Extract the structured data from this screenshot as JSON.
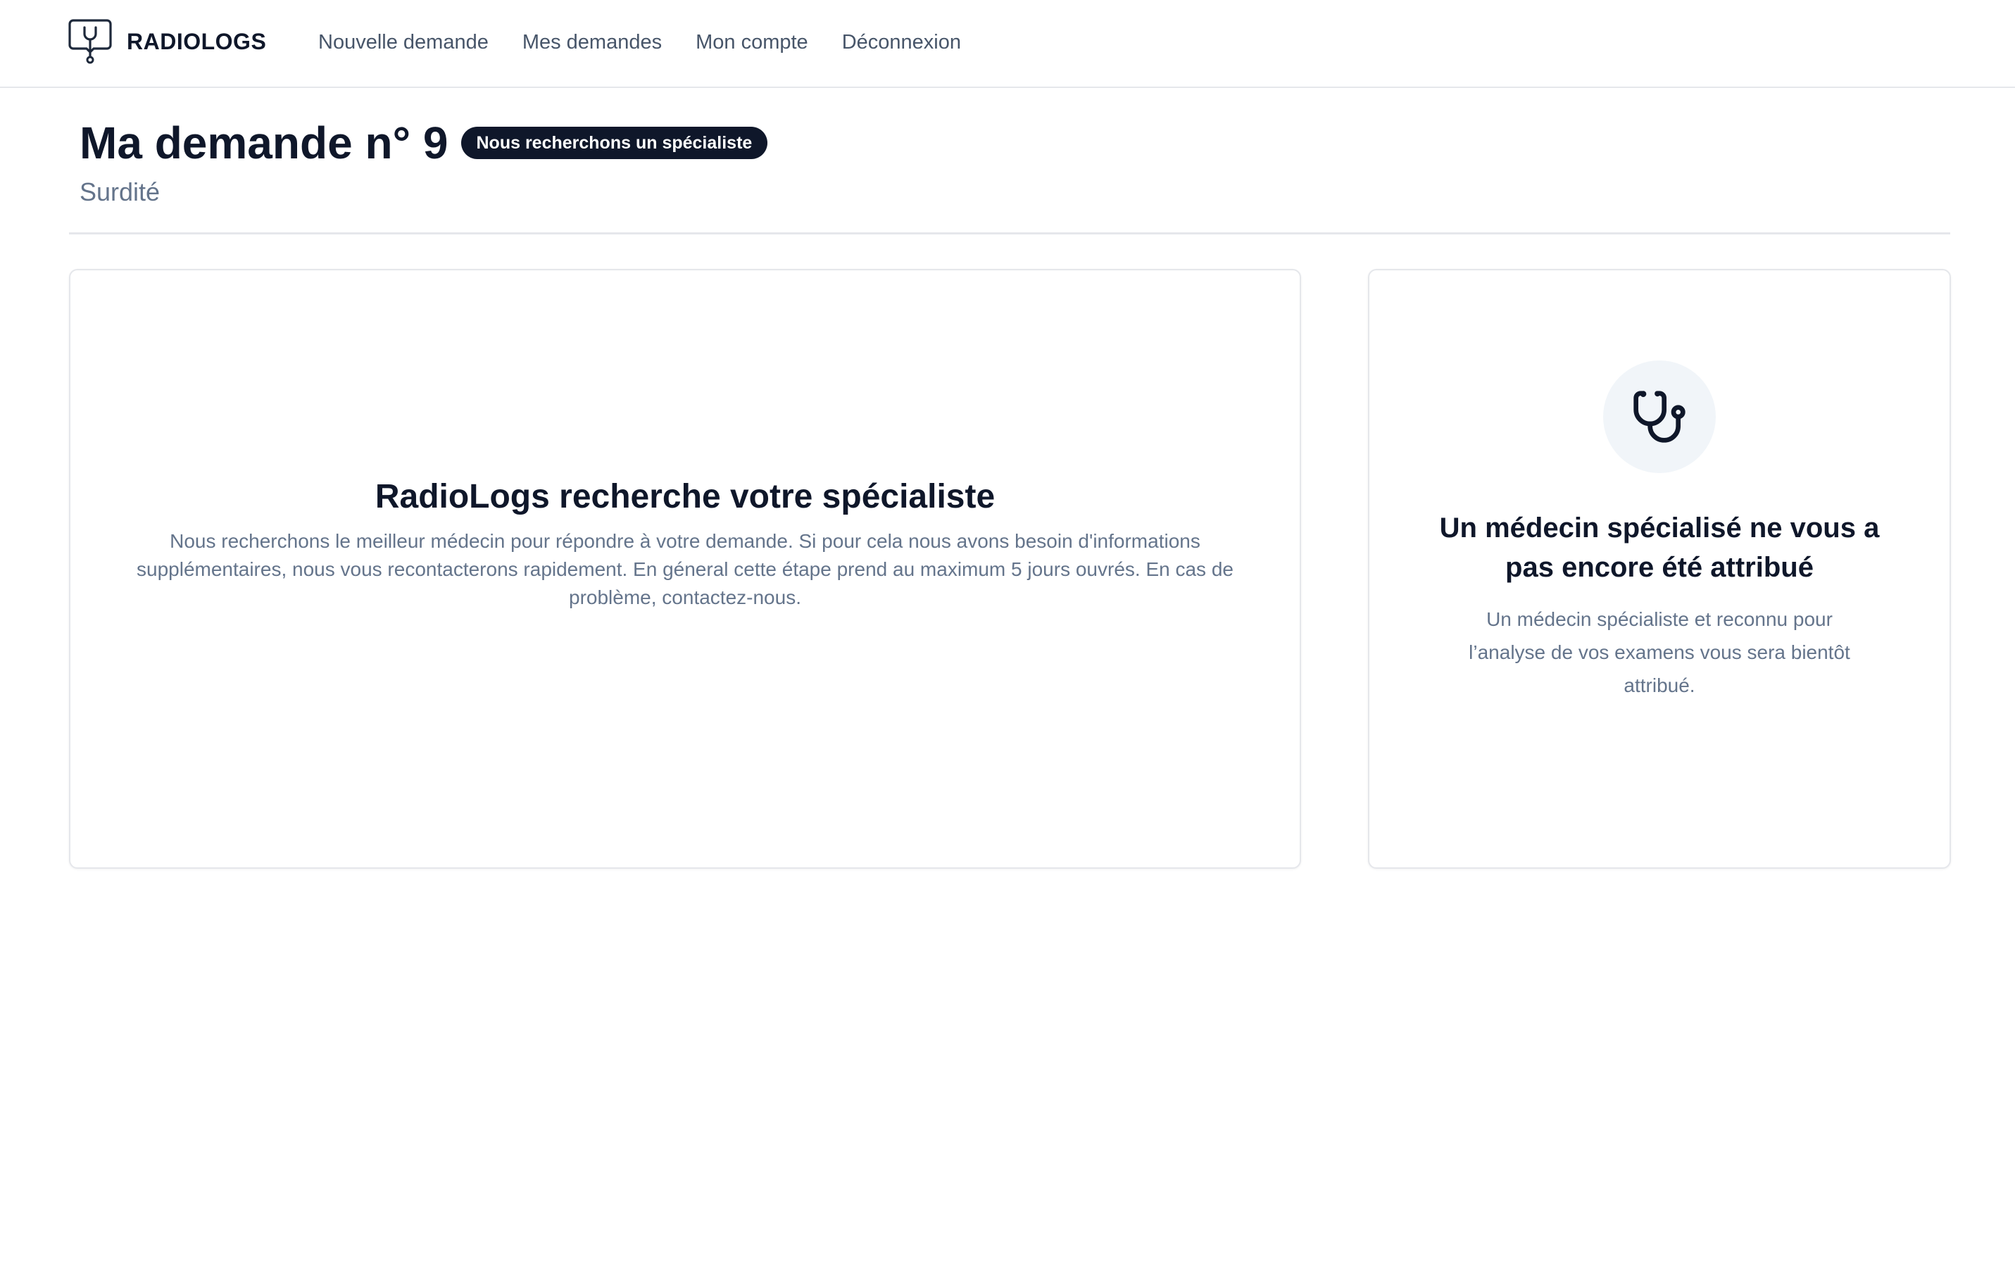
{
  "header": {
    "brand_name": "RADIOLOGS",
    "brand_icon": "stethoscope-chat-icon",
    "nav": [
      {
        "label": "Nouvelle demande"
      },
      {
        "label": "Mes demandes"
      },
      {
        "label": "Mon compte"
      },
      {
        "label": "Déconnexion"
      }
    ]
  },
  "page": {
    "title": "Ma demande n° 9",
    "status_badge": "Nous recherchons un spécialiste",
    "subtitle": "Surdité"
  },
  "main_card": {
    "title": "RadioLogs recherche votre spécialiste",
    "text": "Nous recherchons le meilleur médecin pour répondre à votre demande. Si pour cela nous avons besoin d'informations supplémentaires, nous vous recontacterons rapidement. En géneral cette étape prend au maximum 5 jours ouvrés. En cas de problème, contactez-nous."
  },
  "side_card": {
    "icon": "stethoscope-icon",
    "title": "Un médecin spécialisé ne vous a pas encore été attribué",
    "text": "Un médecin spécialiste et reconnu pour l’analyse de vos examens vous sera bientôt attribué."
  },
  "colors": {
    "primary": "#0f172a",
    "muted_text": "#64748b",
    "nav_text": "#475569",
    "border": "#e5e7eb",
    "icon_bg": "#f1f5f9"
  }
}
